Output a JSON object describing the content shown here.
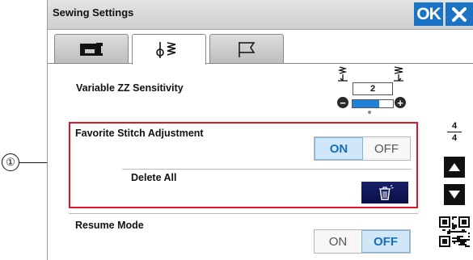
{
  "window": {
    "title": "Sewing Settings",
    "ok_label": "OK",
    "close_icon": "close-icon"
  },
  "tabs": [
    {
      "icon": "sewing-machine-icon",
      "active": false
    },
    {
      "icon": "stitch-settings-icon",
      "active": true
    },
    {
      "icon": "flag-icon",
      "active": false
    }
  ],
  "settings": {
    "zz_sensitivity": {
      "label": "Variable ZZ Sensitivity",
      "value": "2",
      "level_fraction": 0.65
    },
    "favorite_stitch": {
      "label": "Favorite Stitch Adjustment",
      "on_label": "ON",
      "off_label": "OFF",
      "selected": "ON"
    },
    "delete_all": {
      "label": "Delete All"
    },
    "resume_mode": {
      "label": "Resume Mode",
      "on_label": "ON",
      "off_label": "OFF",
      "selected": "OFF"
    }
  },
  "pager": {
    "current": "4",
    "total": "4"
  },
  "callout": {
    "number": "①"
  },
  "colors": {
    "accent": "#1b73c6",
    "highlight": "#e0132b",
    "toggle_selected": "#cfe7f7",
    "trash_button": "#0a0f45"
  }
}
